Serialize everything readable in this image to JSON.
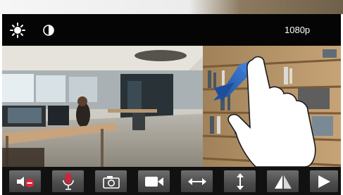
{
  "header": {
    "resolution": "1080p",
    "brightness_icon": "sun-icon",
    "contrast_icon": "half-circle-icon"
  },
  "toolbar": {
    "buttons": [
      {
        "name": "speaker-mute",
        "icon": "speaker-mute-icon"
      },
      {
        "name": "microphone",
        "icon": "microphone-icon"
      },
      {
        "name": "snapshot",
        "icon": "camera-icon"
      },
      {
        "name": "record",
        "icon": "video-camera-icon"
      },
      {
        "name": "flip-horizontal",
        "icon": "horizontal-arrows-icon"
      },
      {
        "name": "flip-vertical",
        "icon": "vertical-arrows-icon"
      },
      {
        "name": "mirror",
        "icon": "triangle-mirror-icon"
      },
      {
        "name": "play",
        "icon": "play-icon"
      }
    ],
    "colors": {
      "mute": "#e0243a",
      "mic": "#d6223a"
    }
  }
}
